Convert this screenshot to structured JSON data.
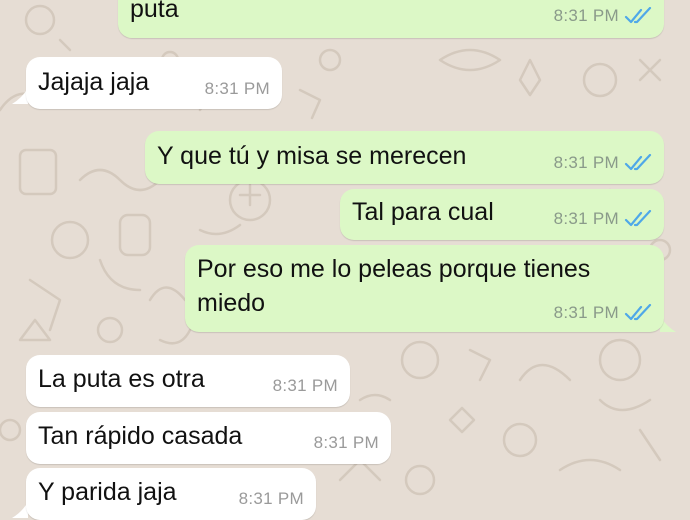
{
  "colors": {
    "outgoing_bubble": "#dcf8c6",
    "incoming_bubble": "#ffffff",
    "read_ticks": "#4fa8e8",
    "wallpaper": "#e6ddd4"
  },
  "messages": [
    {
      "direction": "outgoing",
      "text": "puta",
      "time": "8:31 PM",
      "status": "read"
    },
    {
      "direction": "incoming",
      "text": "Jajaja jaja",
      "time": "8:31 PM"
    },
    {
      "direction": "outgoing",
      "text": "Y que tú y misa se merecen",
      "time": "8:31 PM",
      "status": "read"
    },
    {
      "direction": "outgoing",
      "text": "Tal para cual",
      "time": "8:31 PM",
      "status": "read"
    },
    {
      "direction": "outgoing",
      "text": "Por eso me lo peleas porque tienes miedo",
      "time": "8:31 PM",
      "status": "read"
    },
    {
      "direction": "incoming",
      "text": "La puta es otra",
      "time": "8:31 PM"
    },
    {
      "direction": "incoming",
      "text": "Tan rápido casada",
      "time": "8:31 PM"
    },
    {
      "direction": "incoming",
      "text": "Y parida jaja",
      "time": "8:31 PM"
    }
  ]
}
